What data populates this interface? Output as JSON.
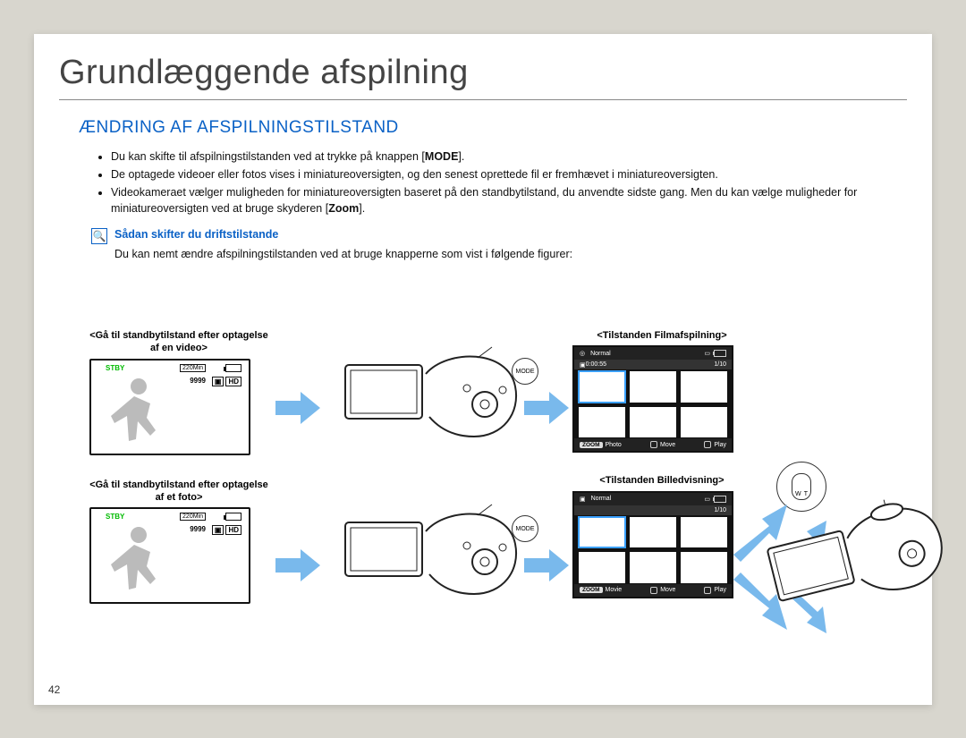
{
  "page_number": "42",
  "title": "Grundlæggende afspilning",
  "section_title": "ÆNDRING AF AFSPILNINGSTILSTAND",
  "bullets": [
    {
      "pre": "Du kan skifte til afspilningstilstanden ved at trykke på knappen [",
      "bold": "MODE",
      "post": "]."
    },
    {
      "pre": "De optagede videoer eller fotos vises i miniatureoversigten, og den senest oprettede fil er fremhævet i miniatureoversigten.",
      "bold": "",
      "post": ""
    },
    {
      "pre": "Videokameraet vælger muligheden for miniatureoversigten baseret på den standbytilstand, du anvendte sidste gang. Men du kan vælge muligheder for miniatureoversigten ved at bruge skyderen [",
      "bold": "Zoom",
      "post": "]."
    }
  ],
  "note": {
    "title": "Sådan skifter du driftstilstande",
    "body": "Du kan nemt ændre afspilningstilstanden ved at bruge knapperne som vist i følgende figurer:"
  },
  "captions": {
    "standby_video": "<Gå til standbytilstand efter optagelse af en video>",
    "standby_photo": "<Gå til standbytilstand efter optagelse af et foto>",
    "film": "<Tilstanden Filmafspilning>",
    "image": "<Tilstanden Billedvisning>"
  },
  "osd": {
    "stby": "STBY",
    "minutes": "220Min",
    "count": "9999",
    "hd": "HD"
  },
  "mode_label": "MODE",
  "playback": {
    "normal": "Normal",
    "time": "0:00:55",
    "index": "1/10",
    "zoom_label": "ZOOM",
    "photo": "Photo",
    "movie": "Movie",
    "move": "Move",
    "play": "Play"
  },
  "zoom_lever": {
    "w": "W",
    "t": "T"
  }
}
